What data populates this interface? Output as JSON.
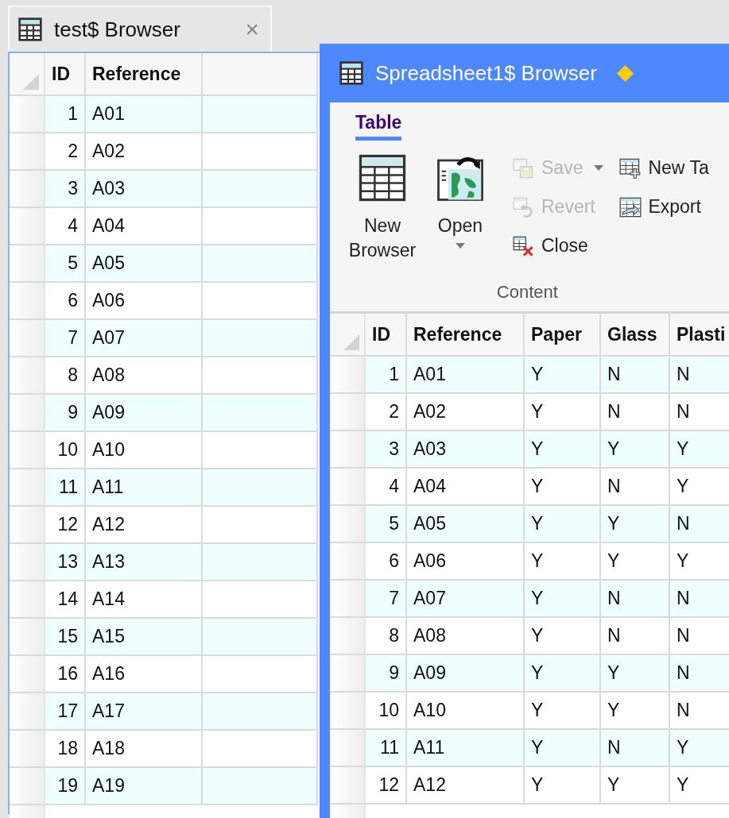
{
  "background_window": {
    "tab": {
      "title": "test$ Browser",
      "close": "×"
    },
    "table": {
      "columns": [
        "ID",
        "Reference"
      ],
      "rows": [
        [
          "1",
          "A01"
        ],
        [
          "2",
          "A02"
        ],
        [
          "3",
          "A03"
        ],
        [
          "4",
          "A04"
        ],
        [
          "5",
          "A05"
        ],
        [
          "6",
          "A06"
        ],
        [
          "7",
          "A07"
        ],
        [
          "8",
          "A08"
        ],
        [
          "9",
          "A09"
        ],
        [
          "10",
          "A10"
        ],
        [
          "11",
          "A11"
        ],
        [
          "12",
          "A12"
        ],
        [
          "13",
          "A13"
        ],
        [
          "14",
          "A14"
        ],
        [
          "15",
          "A15"
        ],
        [
          "16",
          "A16"
        ],
        [
          "17",
          "A17"
        ],
        [
          "18",
          "A18"
        ],
        [
          "19",
          "A19"
        ]
      ]
    }
  },
  "browser_window": {
    "title": "Spreadsheet1$ Browser",
    "modified": true,
    "ribbon": {
      "tabs": [
        {
          "label": "Table",
          "selected": true
        }
      ],
      "groups": [
        {
          "label": "Content",
          "columns": [
            {
              "kind": "large",
              "buttons": [
                {
                  "label": "New Browser",
                  "disabled": false,
                  "dropdown": false
                }
              ]
            },
            {
              "kind": "large",
              "buttons": [
                {
                  "label": "Open",
                  "disabled": false,
                  "dropdown": true
                }
              ]
            },
            {
              "kind": "small",
              "buttons": [
                {
                  "label": "Save",
                  "disabled": true,
                  "dropdown": true
                },
                {
                  "label": "Revert",
                  "disabled": true,
                  "dropdown": false
                },
                {
                  "label": "Close",
                  "disabled": false,
                  "dropdown": false
                }
              ]
            },
            {
              "kind": "small",
              "buttons": [
                {
                  "label": "New Ta",
                  "disabled": false,
                  "dropdown": false
                },
                {
                  "label": "Export",
                  "disabled": false,
                  "dropdown": false
                }
              ]
            }
          ]
        }
      ]
    },
    "table": {
      "columns": [
        "ID",
        "Reference",
        "Paper",
        "Glass",
        "Plasti"
      ],
      "rows": [
        [
          "1",
          "A01",
          "Y",
          "N",
          "N"
        ],
        [
          "2",
          "A02",
          "Y",
          "N",
          "N"
        ],
        [
          "3",
          "A03",
          "Y",
          "Y",
          "Y"
        ],
        [
          "4",
          "A04",
          "Y",
          "N",
          "Y"
        ],
        [
          "5",
          "A05",
          "Y",
          "Y",
          "N"
        ],
        [
          "6",
          "A06",
          "Y",
          "Y",
          "Y"
        ],
        [
          "7",
          "A07",
          "Y",
          "N",
          "N"
        ],
        [
          "8",
          "A08",
          "Y",
          "N",
          "N"
        ],
        [
          "9",
          "A09",
          "Y",
          "Y",
          "N"
        ],
        [
          "10",
          "A10",
          "Y",
          "Y",
          "N"
        ],
        [
          "11",
          "A11",
          "Y",
          "N",
          "Y"
        ],
        [
          "12",
          "A12",
          "Y",
          "Y",
          "Y"
        ]
      ]
    }
  }
}
